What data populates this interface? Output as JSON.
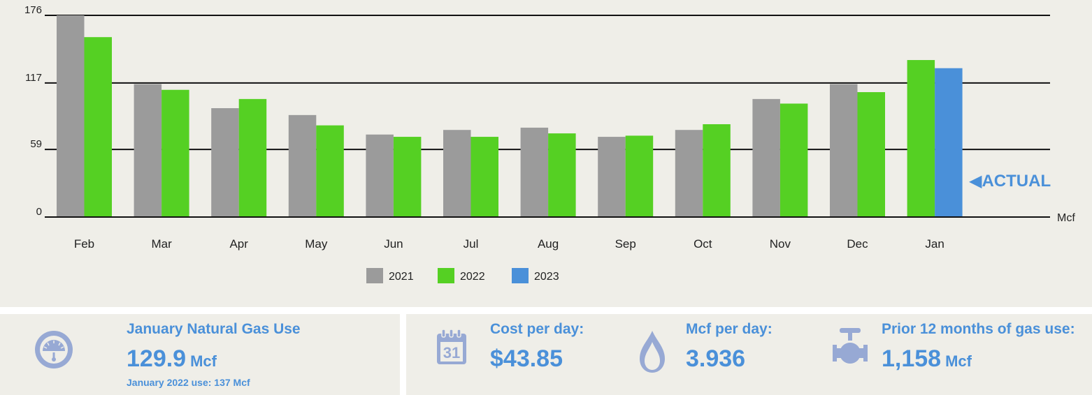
{
  "chart_data": {
    "type": "bar",
    "categories": [
      "Feb",
      "Mar",
      "Apr",
      "May",
      "Jun",
      "Jul",
      "Aug",
      "Sep",
      "Oct",
      "Nov",
      "Dec",
      "Jan"
    ],
    "series": [
      {
        "name": "2021",
        "color": "#9b9b9b",
        "values": [
          176,
          116,
          95,
          89,
          72,
          76,
          78,
          70,
          76,
          103,
          116,
          null
        ]
      },
      {
        "name": "2022",
        "color": "#55d023",
        "values": [
          157,
          111,
          103,
          80,
          70,
          70,
          73,
          71,
          81,
          99,
          109,
          137
        ]
      },
      {
        "name": "2023",
        "color": "#4a90d9",
        "values": [
          null,
          null,
          null,
          null,
          null,
          null,
          null,
          null,
          null,
          null,
          null,
          129.9
        ]
      }
    ],
    "yticks": [
      0,
      59,
      117,
      176
    ],
    "ylim": [
      0,
      176
    ],
    "yunit": "Mcf",
    "grid": true,
    "legend_position": "bottom-center",
    "annotation": "◀ACTUAL"
  },
  "summary": {
    "january_use": {
      "title": "January Natural Gas Use",
      "value": "129.9",
      "unit": "Mcf",
      "note": "January 2022 use: 137 Mcf",
      "icon": "gas-meter-icon"
    },
    "cost_per_day": {
      "title": "Cost per day:",
      "value": "$43.85",
      "icon": "calendar-icon",
      "calendar_day": "31"
    },
    "mcf_per_day": {
      "title": "Mcf per day:",
      "value": "3.936",
      "icon": "flame-icon"
    },
    "prior_12_months": {
      "title": "Prior 12 months of gas use:",
      "value": "1,158",
      "unit": "Mcf",
      "icon": "gas-valve-icon"
    },
    "accent_color": "#4a90d9",
    "icon_color": "#97a9d4"
  }
}
